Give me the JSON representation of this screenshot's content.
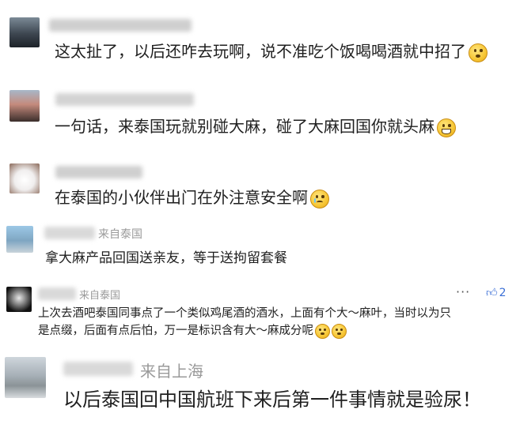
{
  "comments": [
    {
      "location": "",
      "text": "这太扯了，以后还咋去玩啊，说不准吃个饭喝喝酒就中招了",
      "emoji": "dizzy-emoji"
    },
    {
      "location": "",
      "text": "一句话，来泰国玩就别碰大麻，碰了大麻回国你就头麻",
      "emoji": "grin-emoji"
    },
    {
      "location": "",
      "text": "在泰国的小伙伴出门在外注意安全啊",
      "emoji": "cry-emoji"
    },
    {
      "location": "来自泰国",
      "text": "拿大麻产品回国送亲友，等于送拘留套餐",
      "emoji": ""
    },
    {
      "location": "来自泰国",
      "text_line1": "上次去酒吧泰国同事点了一个类似鸡尾酒的酒水，上面有个大～麻叶，当时以为只",
      "text_line2": "是点缀，后面有点后怕，万一是标识含有大～麻成分呢",
      "more": "···",
      "likes": "2"
    },
    {
      "location": "来自上海",
      "text": "以后泰国回中国航班下来后第一件事情就是验尿！"
    }
  ],
  "colors": {
    "accent": "#3b6fd6",
    "location": "#9a9a9a"
  }
}
